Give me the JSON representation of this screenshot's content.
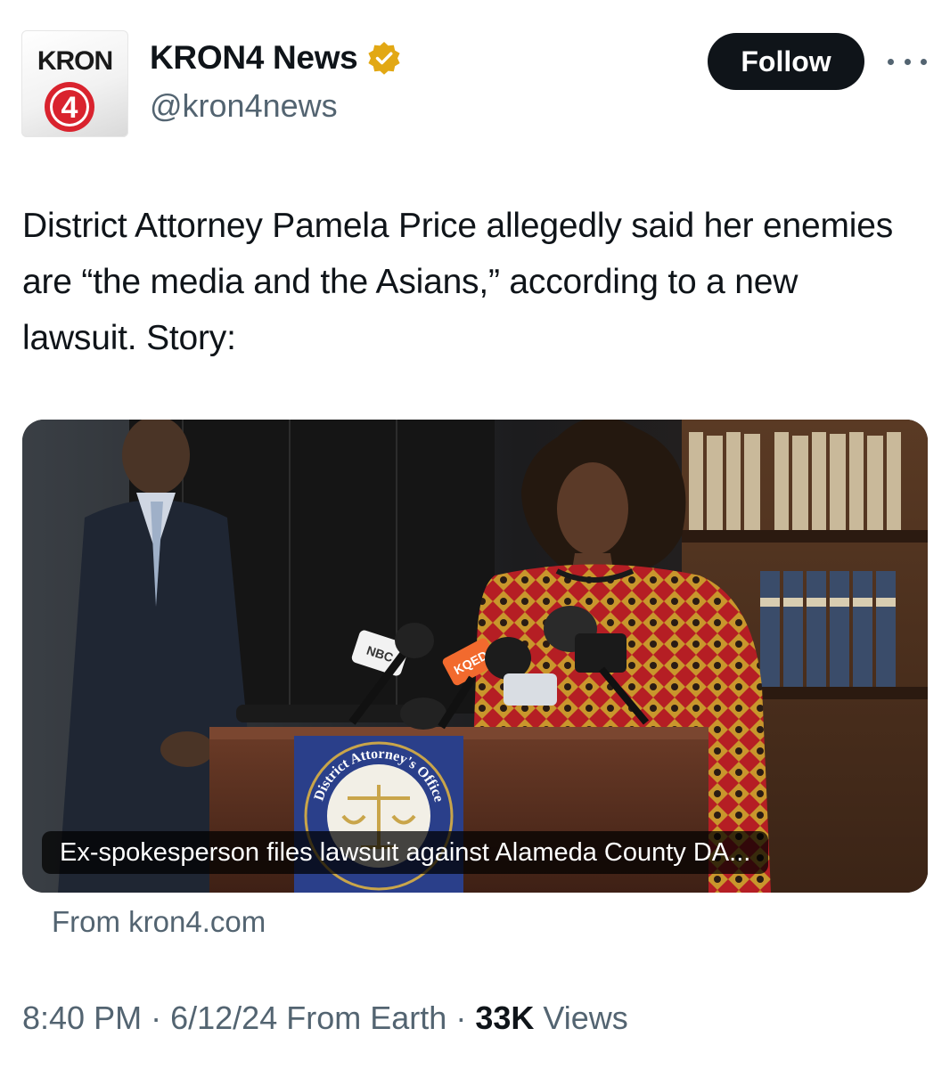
{
  "account": {
    "logo_top_text": "KRON",
    "logo_number": "4",
    "display_name": "KRON4 News",
    "handle": "@kron4news",
    "verified": true,
    "verified_color": "#e2a814"
  },
  "actions": {
    "follow_label": "Follow"
  },
  "tweet": {
    "text": "District Attorney Pamela Price allegedly said her enemies are “the media and the Asians,” according to a new lawsuit. Story:"
  },
  "link_card": {
    "headline": "Ex-spokesperson files lawsuit against Alameda County DA...",
    "source": "From kron4.com",
    "podium_seal_text": "District Attorney's Office",
    "mic_labels": [
      "NBC",
      "KQED"
    ]
  },
  "meta": {
    "time": "8:40 PM",
    "separator": "·",
    "date": "6/12/24",
    "source": "From Earth",
    "views_count": "33K",
    "views_label": "Views"
  },
  "colors": {
    "text_primary": "#0f1419",
    "text_secondary": "#536471",
    "follow_bg": "#0f1419",
    "kron_red": "#d9232e"
  }
}
